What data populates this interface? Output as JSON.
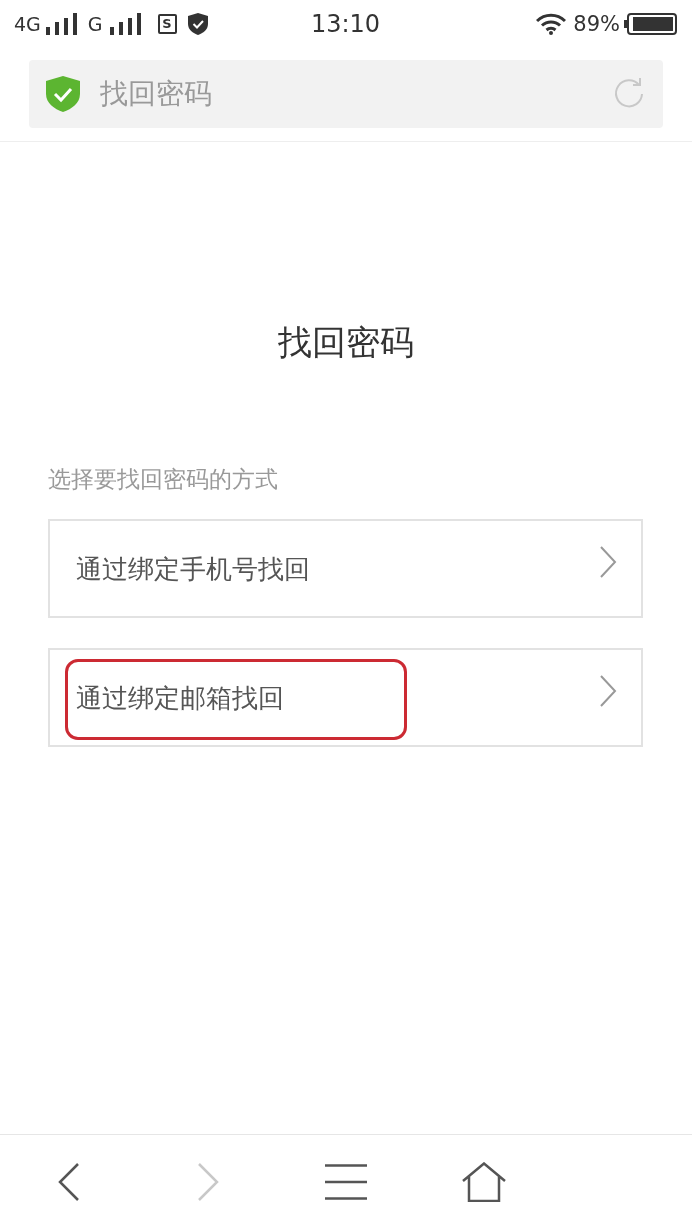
{
  "status_bar": {
    "network_1": "4G",
    "network_2": "G",
    "notification": "S",
    "time": "13:10",
    "battery": "89%"
  },
  "address_bar": {
    "title": "找回密码"
  },
  "page": {
    "heading": "找回密码",
    "prompt": "选择要找回密码的方式",
    "options": [
      {
        "label": "通过绑定手机号找回",
        "highlighted": false
      },
      {
        "label": "通过绑定邮箱找回",
        "highlighted": true
      }
    ]
  },
  "bottom_nav": [
    {
      "kind": "back",
      "disabled": false
    },
    {
      "kind": "forward",
      "disabled": true
    },
    {
      "kind": "menu",
      "disabled": false
    },
    {
      "kind": "home",
      "disabled": false
    }
  ]
}
